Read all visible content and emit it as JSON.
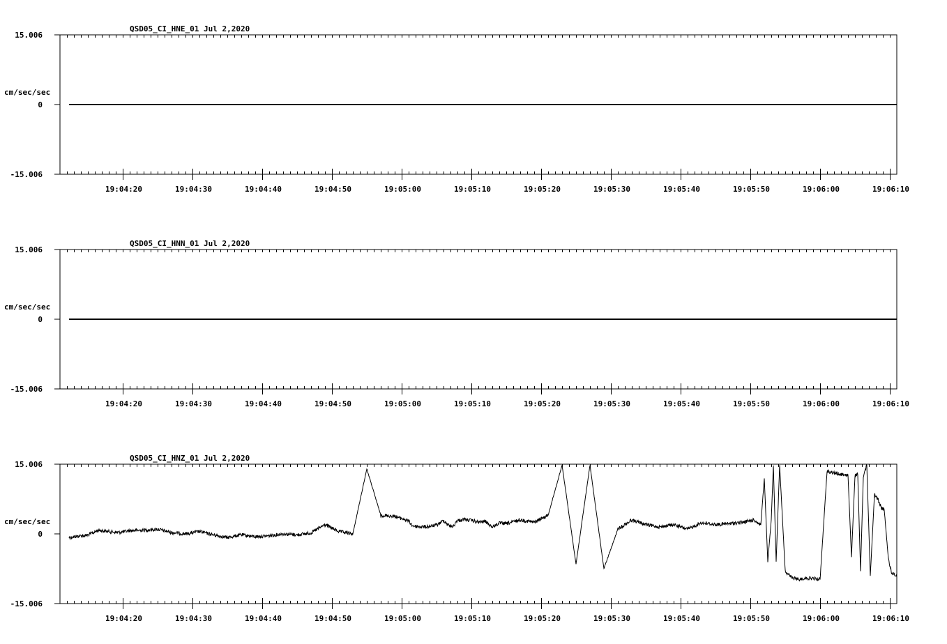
{
  "chart_data": [
    {
      "type": "line",
      "title": "QSD05_CI_HNE_01  Jul 2,2020",
      "ylabel": "cm/sec/sec",
      "ylim": [
        -15.006,
        15.006
      ],
      "ytick_labels": [
        "15.006",
        "0",
        "-15.006"
      ],
      "x_range": [
        "19:04:11",
        "19:06:11"
      ],
      "xtick_labels": [
        "19:04:20",
        "19:04:30",
        "19:04:40",
        "19:04:50",
        "19:05:00",
        "19:05:10",
        "19:05:20",
        "19:05:30",
        "19:05:40",
        "19:05:50",
        "19:06:00",
        "19:06:10"
      ],
      "grid": false,
      "series": [
        {
          "x": [
            1.3,
            120
          ],
          "y": [
            0,
            0
          ]
        }
      ]
    },
    {
      "type": "line",
      "title": "QSD05_CI_HNN_01  Jul 2,2020",
      "ylabel": "cm/sec/sec",
      "ylim": [
        -15.006,
        15.006
      ],
      "ytick_labels": [
        "15.006",
        "0",
        "-15.006"
      ],
      "x_range": [
        "19:04:11",
        "19:06:11"
      ],
      "xtick_labels": [
        "19:04:20",
        "19:04:30",
        "19:04:40",
        "19:04:50",
        "19:05:00",
        "19:05:10",
        "19:05:20",
        "19:05:30",
        "19:05:40",
        "19:05:50",
        "19:06:00",
        "19:06:10"
      ],
      "grid": false,
      "series": [
        {
          "x": [
            1.3,
            120
          ],
          "y": [
            0,
            0
          ]
        }
      ]
    },
    {
      "type": "line",
      "title": "QSD05_CI_HNZ_01  Jul 2,2020",
      "ylabel": "cm/sec/sec",
      "ylim": [
        -15.006,
        15.006
      ],
      "ytick_labels": [
        "15.006",
        "0",
        "-15.006"
      ],
      "x_range": [
        "19:04:11",
        "19:06:11"
      ],
      "xtick_labels": [
        "19:04:20",
        "19:04:30",
        "19:04:40",
        "19:04:50",
        "19:05:00",
        "19:05:10",
        "19:05:20",
        "19:05:30",
        "19:05:40",
        "19:05:50",
        "19:06:00",
        "19:06:10"
      ],
      "grid": false,
      "series": [
        {
          "x": [
            1.3,
            2.5,
            4.0,
            5.5,
            7.0,
            8.5,
            10.0,
            12.0,
            14.0,
            16.0,
            18.0,
            20.0,
            22.0,
            24.0,
            26.0,
            28.0,
            30.0,
            32.0,
            34.0,
            36.0,
            38.0,
            40.0,
            42.0,
            44.0,
            46.0,
            48.0,
            50.0,
            50.5,
            51.0,
            52.0,
            53.0,
            54.0,
            55.0,
            55.8,
            56.1,
            56.4,
            56.9,
            57.5,
            58.0,
            59.0,
            60.0,
            61.0,
            62.0,
            63.0,
            63.5,
            64.0,
            66.0,
            68.0,
            70.0,
            72.0,
            74.0,
            76.0,
            78.0,
            80.0,
            82.0,
            84.0,
            86.0,
            88.0,
            90.0,
            92.0,
            94.0,
            96.0,
            98.0,
            99.5,
            100.5,
            101.0,
            101.5,
            102.0,
            102.3,
            102.7,
            103.2,
            104.0,
            105.0,
            106.0,
            107.0,
            108.0,
            109.0,
            110.0,
            112.0,
            113.0,
            113.5,
            114.0,
            114.4,
            114.8,
            115.2,
            115.7,
            116.2,
            116.8,
            117.3,
            117.8,
            118.2,
            118.8,
            119.3,
            120.0
          ],
          "y": [
            -0.8,
            -0.5,
            -0.3,
            0.8,
            0.5,
            0.3,
            0.7,
            0.8,
            1.0,
            0.3,
            0.0,
            0.5,
            -0.2,
            -0.8,
            -0.2,
            -0.6,
            -0.4,
            0.0,
            -0.2,
            0.2,
            2.0,
            0.5,
            0.0,
            14.0,
            4.0,
            3.8,
            2.8,
            1.8,
            1.6,
            1.5,
            1.6,
            1.9,
            2.9,
            1.8,
            1.7,
            1.6,
            2.8,
            3.0,
            3.1,
            2.9,
            2.5,
            2.7,
            1.5,
            2.3,
            2.3,
            2.2,
            3.0,
            2.5,
            4.0,
            14.8,
            -6.5,
            14.8,
            -7.5,
            1.0,
            3.0,
            2.0,
            1.5,
            2.0,
            1.0,
            2.4,
            2.0,
            2.2,
            2.5,
            3.0,
            2.0,
            12.0,
            -6.0,
            3.0,
            14.8,
            -6.0,
            14.8,
            -8.0,
            -9.5,
            -9.8,
            -9.5,
            -9.6,
            -9.8,
            13.5,
            12.8,
            12.7,
            -5.0,
            12.5,
            12.8,
            -8.0,
            12.3,
            14.8,
            -9.0,
            8.5,
            7.5,
            5.5,
            5.2,
            -5.5,
            -8.5,
            -9.0
          ]
        }
      ]
    }
  ]
}
